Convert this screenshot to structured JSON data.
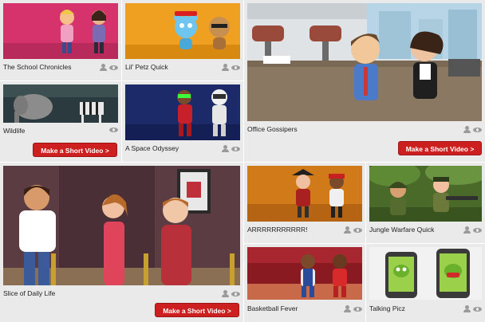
{
  "tiles": {
    "school": {
      "title": "The School Chronicles"
    },
    "petz": {
      "title": "Lil' Petz Quick"
    },
    "office": {
      "title": "Office Gossipers"
    },
    "wildlife": {
      "title": "Wildlife"
    },
    "space": {
      "title": "A Space Odyssey"
    },
    "daily": {
      "title": "Slice of Daily Life"
    },
    "pirate": {
      "title": "ARRRRRRRRRRR!"
    },
    "jungle": {
      "title": "Jungle Warfare Quick"
    },
    "basketball": {
      "title": "Basketball Fever"
    },
    "picz": {
      "title": "Talking Picz"
    }
  },
  "cta_label": "Make a Short Video >",
  "icons": {
    "person": "person-icon",
    "eye": "eye-icon"
  },
  "colors": {
    "cta": "#cc1f1f",
    "tile_bg": "#eaeaea"
  }
}
